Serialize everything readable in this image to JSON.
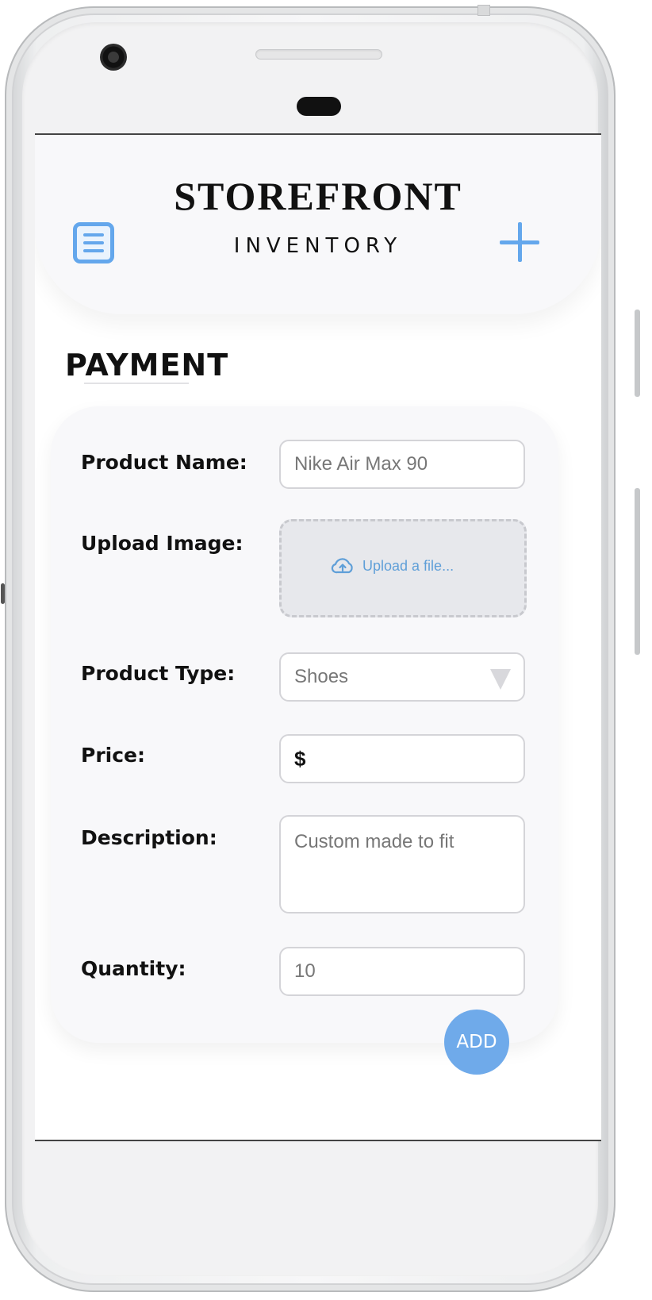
{
  "header": {
    "title": "STOREFRONT",
    "subtitle": "INVENTORY",
    "menu_icon": "menu-list-icon",
    "add_icon": "plus-icon"
  },
  "section": {
    "title": "PAYMENT"
  },
  "form": {
    "product_name_label": "Product Name:",
    "product_name_value": "Nike Air Max 90",
    "upload_label": "Upload Image:",
    "upload_text": "Upload a file...",
    "upload_icon": "cloud-upload-icon",
    "product_type_label": "Product Type:",
    "product_type_value": "Shoes",
    "price_label": "Price:",
    "price_value": "$",
    "description_label": "Description:",
    "description_value": "Custom made to fit",
    "quantity_label": "Quantity:",
    "quantity_value": "10"
  },
  "actions": {
    "add_label": "ADD"
  },
  "colors": {
    "accent": "#64a7ec",
    "add_button": "#6faaea",
    "card_background": "#f8f8fa",
    "upload_background": "#e7e8ec"
  }
}
